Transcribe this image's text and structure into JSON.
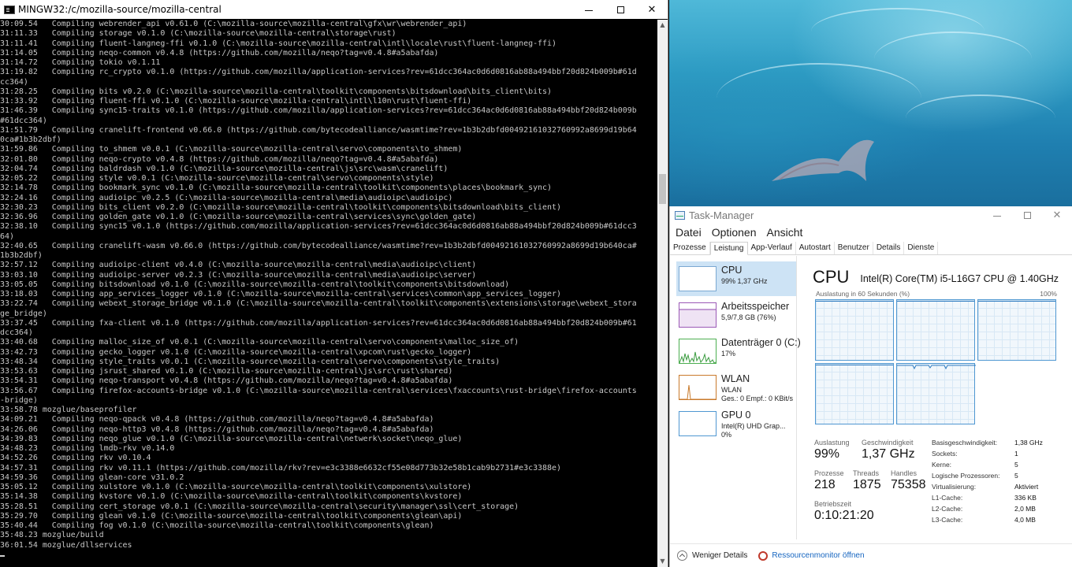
{
  "terminal": {
    "title": "MINGW32:/c/mozilla-source/mozilla-central",
    "lines": [
      "30:09.54   Compiling webrender_api v0.61.0 (C:\\mozilla-source\\mozilla-central\\gfx\\wr\\webrender_api)",
      "31:11.33   Compiling storage v0.1.0 (C:\\mozilla-source\\mozilla-central\\storage\\rust)",
      "31:11.41   Compiling fluent-langneg-ffi v0.1.0 (C:\\mozilla-source\\mozilla-central\\intl\\locale\\rust\\fluent-langneg-ffi)",
      "31:14.05   Compiling neqo-common v0.4.8 (https://github.com/mozilla/neqo?tag=v0.4.8#a5abafda)",
      "31:14.72   Compiling tokio v0.1.11",
      "31:19.82   Compiling rc_crypto v0.1.0 (https://github.com/mozilla/application-services?rev=61dcc364ac0d6d0816ab88a494bbf20d824b009b#61d",
      "cc364)",
      "31:28.25   Compiling bits v0.2.0 (C:\\mozilla-source\\mozilla-central\\toolkit\\components\\bitsdownload\\bits_client\\bits)",
      "31:33.92   Compiling fluent-ffi v0.1.0 (C:\\mozilla-source\\mozilla-central\\intl\\l10n\\rust\\fluent-ffi)",
      "31:46.39   Compiling sync15-traits v0.1.0 (https://github.com/mozilla/application-services?rev=61dcc364ac0d6d0816ab88a494bbf20d824b009b",
      "#61dcc364)",
      "31:51.79   Compiling cranelift-frontend v0.66.0 (https://github.com/bytecodealliance/wasmtime?rev=1b3b2dbfd00492161032760992a8699d19b64",
      "0ca#1b3b2dbf)",
      "31:59.86   Compiling to_shmem v0.0.1 (C:\\mozilla-source\\mozilla-central\\servo\\components\\to_shmem)",
      "32:01.80   Compiling neqo-crypto v0.4.8 (https://github.com/mozilla/neqo?tag=v0.4.8#a5abafda)",
      "32:04.74   Compiling baldrdash v0.1.0 (C:\\mozilla-source\\mozilla-central\\js\\src\\wasm\\cranelift)",
      "32:05.22   Compiling style v0.0.1 (C:\\mozilla-source\\mozilla-central\\servo\\components\\style)",
      "32:14.78   Compiling bookmark_sync v0.1.0 (C:\\mozilla-source\\mozilla-central\\toolkit\\components\\places\\bookmark_sync)",
      "32:24.16   Compiling audioipc v0.2.5 (C:\\mozilla-source\\mozilla-central\\media\\audioipc\\audioipc)",
      "32:30.23   Compiling bits_client v0.2.0 (C:\\mozilla-source\\mozilla-central\\toolkit\\components\\bitsdownload\\bits_client)",
      "32:36.96   Compiling golden_gate v0.1.0 (C:\\mozilla-source\\mozilla-central\\services\\sync\\golden_gate)",
      "32:38.10   Compiling sync15 v0.1.0 (https://github.com/mozilla/application-services?rev=61dcc364ac0d6d0816ab88a494bbf20d824b009b#61dcc3",
      "64)",
      "32:40.65   Compiling cranelift-wasm v0.66.0 (https://github.com/bytecodealliance/wasmtime?rev=1b3b2dbfd00492161032760992a8699d19b640ca#",
      "1b3b2dbf)",
      "32:57.12   Compiling audioipc-client v0.4.0 (C:\\mozilla-source\\mozilla-central\\media\\audioipc\\client)",
      "33:03.10   Compiling audioipc-server v0.2.3 (C:\\mozilla-source\\mozilla-central\\media\\audioipc\\server)",
      "33:05.05   Compiling bitsdownload v0.1.0 (C:\\mozilla-source\\mozilla-central\\toolkit\\components\\bitsdownload)",
      "33:18.03   Compiling app_services_logger v0.1.0 (C:\\mozilla-source\\mozilla-central\\services\\common\\app_services_logger)",
      "33:22.74   Compiling webext_storage_bridge v0.1.0 (C:\\mozilla-source\\mozilla-central\\toolkit\\components\\extensions\\storage\\webext_stora",
      "ge_bridge)",
      "33:37.45   Compiling fxa-client v0.1.0 (https://github.com/mozilla/application-services?rev=61dcc364ac0d6d0816ab88a494bbf20d824b009b#61",
      "dcc364)",
      "33:40.68   Compiling malloc_size_of v0.0.1 (C:\\mozilla-source\\mozilla-central\\servo\\components\\malloc_size_of)",
      "33:42.73   Compiling gecko_logger v0.1.0 (C:\\mozilla-source\\mozilla-central\\xpcom\\rust\\gecko_logger)",
      "33:48.34   Compiling style_traits v0.0.1 (C:\\mozilla-source\\mozilla-central\\servo\\components\\style_traits)",
      "33:53.63   Compiling jsrust_shared v0.1.0 (C:\\mozilla-source\\mozilla-central\\js\\src\\rust\\shared)",
      "33:54.31   Compiling neqo-transport v0.4.8 (https://github.com/mozilla/neqo?tag=v0.4.8#a5abafda)",
      "33:56.67   Compiling firefox-accounts-bridge v0.1.0 (C:\\mozilla-source\\mozilla-central\\services\\fxaccounts\\rust-bridge\\firefox-accounts",
      "-bridge)",
      "33:58.78 mozglue/baseprofiler",
      "34:09.21   Compiling neqo-qpack v0.4.8 (https://github.com/mozilla/neqo?tag=v0.4.8#a5abafda)",
      "34:26.06   Compiling neqo-http3 v0.4.8 (https://github.com/mozilla/neqo?tag=v0.4.8#a5abafda)",
      "34:39.83   Compiling neqo_glue v0.1.0 (C:\\mozilla-source\\mozilla-central\\netwerk\\socket\\neqo_glue)",
      "34:48.23   Compiling lmdb-rkv v0.14.0",
      "34:52.26   Compiling rkv v0.10.4",
      "34:57.31   Compiling rkv v0.11.1 (https://github.com/mozilla/rkv?rev=e3c3388e6632cf55e08d773b32e58b1cab9b2731#e3c3388e)",
      "34:59.36   Compiling glean-core v31.0.2",
      "35:05.12   Compiling xulstore v0.1.0 (C:\\mozilla-source\\mozilla-central\\toolkit\\components\\xulstore)",
      "35:14.38   Compiling kvstore v0.1.0 (C:\\mozilla-source\\mozilla-central\\toolkit\\components\\kvstore)",
      "35:28.51   Compiling cert_storage v0.0.1 (C:\\mozilla-source\\mozilla-central\\security\\manager\\ssl\\cert_storage)",
      "35:29.70   Compiling glean v0.1.0 (C:\\mozilla-source\\mozilla-central\\toolkit\\components\\glean\\api)",
      "35:40.44   Compiling fog v0.1.0 (C:\\mozilla-source\\mozilla-central\\toolkit\\components\\glean)",
      "35:48.23 mozglue/build",
      "36:01.54 mozglue/dllservices"
    ]
  },
  "taskmanager": {
    "title": "Task-Manager",
    "menu": [
      "Datei",
      "Optionen",
      "Ansicht"
    ],
    "tabs": [
      "Prozesse",
      "Leistung",
      "App-Verlauf",
      "Autostart",
      "Benutzer",
      "Details",
      "Dienste"
    ],
    "active_tab": "Leistung",
    "resources": [
      {
        "name": "CPU",
        "sub": "99% 1,37 GHz",
        "sub2": "",
        "icon": "cpu-graph-icon"
      },
      {
        "name": "Arbeitsspeicher",
        "sub": "5,9/7,8 GB (76%)",
        "sub2": "",
        "icon": "memory-graph-icon"
      },
      {
        "name": "Datenträger 0 (C:)",
        "sub": "17%",
        "sub2": "",
        "icon": "disk-graph-icon"
      },
      {
        "name": "WLAN",
        "sub": "WLAN",
        "sub2": "Ges.: 0 Empf.: 0 KBit/s",
        "icon": "wifi-graph-icon"
      },
      {
        "name": "GPU 0",
        "sub": "Intel(R) UHD Grap...",
        "sub2": "0%",
        "icon": "gpu-graph-icon"
      }
    ],
    "cpu": {
      "title": "CPU",
      "model": "Intel(R) Core(TM) i5-L16G7 CPU @ 1.40GHz",
      "graph_caption": "Auslastung in 60 Sekunden (%)",
      "graph_max": "100%",
      "utilization_label": "Auslastung",
      "utilization": "99%",
      "speed_label": "Geschwindigkeit",
      "speed": "1,37 GHz",
      "processes_label": "Prozesse",
      "processes": "218",
      "threads_label": "Threads",
      "threads": "1875",
      "handles_label": "Handles",
      "handles": "75358",
      "uptime_label": "Betriebszeit",
      "uptime": "0:10:21:20",
      "specs": [
        {
          "label": "Basisgeschwindigkeit:",
          "value": "1,38 GHz"
        },
        {
          "label": "Sockets:",
          "value": "1"
        },
        {
          "label": "Kerne:",
          "value": "5"
        },
        {
          "label": "Logische Prozessoren:",
          "value": "5"
        },
        {
          "label": "Virtualisierung:",
          "value": "Aktiviert"
        },
        {
          "label": "L1-Cache:",
          "value": "336 KB"
        },
        {
          "label": "L2-Cache:",
          "value": "2,0 MB"
        },
        {
          "label": "L3-Cache:",
          "value": "4,0 MB"
        }
      ]
    },
    "footer": {
      "fewer_details": "Weniger Details",
      "resource_monitor": "Ressourcenmonitor öffnen"
    }
  }
}
